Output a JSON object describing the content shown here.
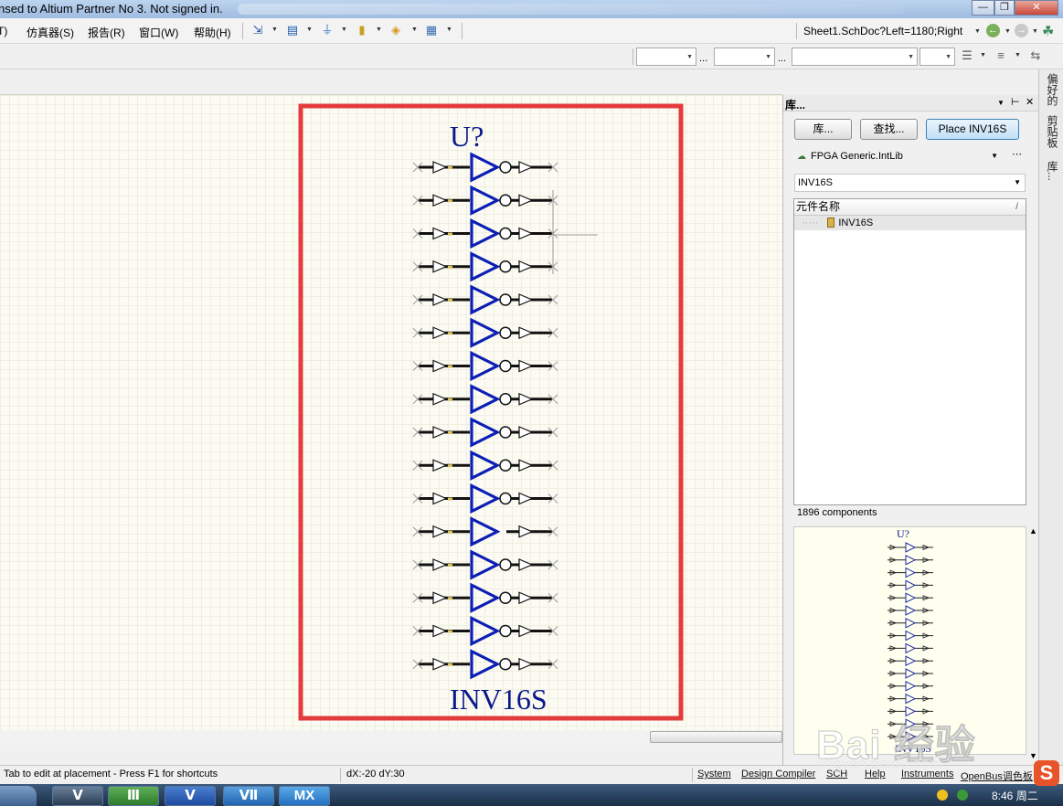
{
  "window": {
    "title": "nsed to Altium Partner No 3. Not signed in."
  },
  "menu": {
    "items": [
      {
        "label": "T)",
        "key": "tools"
      },
      {
        "label": "仿真器(S)",
        "key": "simulator"
      },
      {
        "label": "报告(R)",
        "key": "reports"
      },
      {
        "label": "窗口(W)",
        "key": "window"
      },
      {
        "label": "帮助(H)",
        "key": "help"
      }
    ],
    "path_field": "Sheet1.SchDoc?Left=1180;Right"
  },
  "toolbar2": {
    "dots": "..."
  },
  "schematic": {
    "designator": "U?",
    "part_name": "INV16S",
    "gate_count": 16,
    "highlight_color": "#e43c3c",
    "symbol_color": "#0b1fb5"
  },
  "library_panel": {
    "title": "库...",
    "buttons": {
      "library": "库...",
      "search": "查找...",
      "place": "Place INV16S"
    },
    "library_select": "FPGA Generic.IntLib",
    "filter_value": "INV16S",
    "list_header": "元件名称",
    "list_rows": [
      {
        "name": "INV16S"
      }
    ],
    "component_count": "1896 components",
    "preview": {
      "designator": "U?",
      "part_name": "INV16S"
    }
  },
  "side_tabs": [
    "偏好的",
    "剪贴板",
    "库..."
  ],
  "status": {
    "message": "Tab to edit at placement - Press F1 for shortcuts",
    "coords": "dX:-20 dY:30",
    "buttons": [
      "System",
      "Design Compiler",
      "SCH",
      "Help",
      "Instruments",
      "OpenBus调色板"
    ]
  },
  "taskbar": {
    "apps": [
      "Ⅴ",
      "Ⅲ",
      "Ⅴ",
      "Ⅶ",
      "MX"
    ],
    "clock": "8:46 周二"
  },
  "watermark": {
    "text": "Bai 经验",
    "url": "jingyan.baidu.com"
  }
}
